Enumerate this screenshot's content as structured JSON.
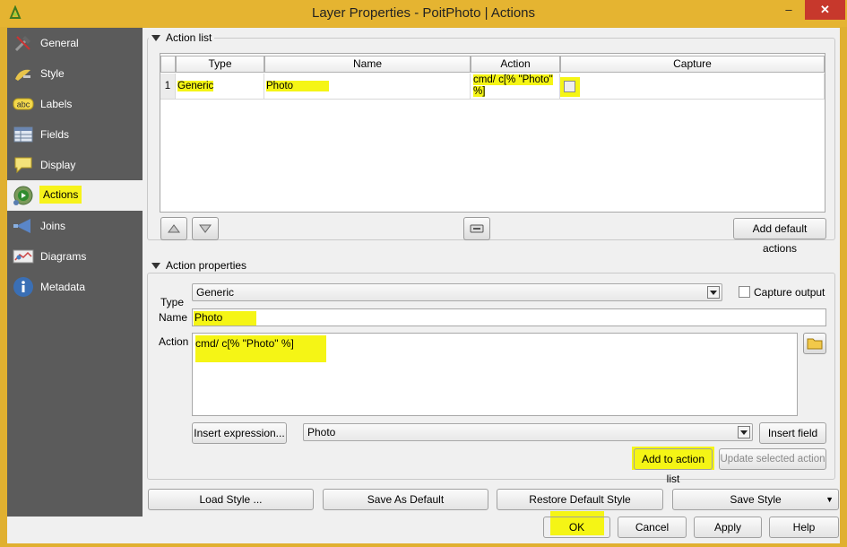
{
  "window": {
    "title": "Layer Properties - PoitPhoto | Actions",
    "minimize_glyph": "–",
    "close_glyph": "✕"
  },
  "sidebar": {
    "items": [
      {
        "label": "General",
        "icon": "general-icon"
      },
      {
        "label": "Style",
        "icon": "style-icon"
      },
      {
        "label": "Labels",
        "icon": "labels-icon"
      },
      {
        "label": "Fields",
        "icon": "fields-icon"
      },
      {
        "label": "Display",
        "icon": "display-icon"
      },
      {
        "label": "Actions",
        "icon": "actions-icon",
        "active": true
      },
      {
        "label": "Joins",
        "icon": "joins-icon"
      },
      {
        "label": "Diagrams",
        "icon": "diagrams-icon"
      },
      {
        "label": "Metadata",
        "icon": "metadata-icon"
      }
    ],
    "labels_icon_text": "abc"
  },
  "action_list": {
    "title": "Action list",
    "columns": [
      "Type",
      "Name",
      "Action",
      "Capture"
    ],
    "rows": [
      {
        "index": "1",
        "type": "Generic",
        "name": "Photo",
        "action": "cmd/ c[% \"Photo\" %]",
        "capture": false
      }
    ],
    "add_default_label": "Add default actions"
  },
  "action_properties": {
    "title": "Action properties",
    "type_label": "Type",
    "type_value": "Generic",
    "capture_output_label": "Capture output",
    "name_label": "Name",
    "name_value": "Photo",
    "action_label": "Action",
    "action_value": "cmd/ c[% \"Photo\" %]",
    "insert_expression_label": "Insert expression...",
    "field_value": "Photo",
    "insert_field_label": "Insert field",
    "add_to_list_label": "Add to action list",
    "update_selected_label": "Update selected action"
  },
  "footer": {
    "load_style": "Load Style ...",
    "save_default": "Save As Default",
    "restore_default": "Restore Default Style",
    "save_style": "Save Style",
    "ok": "OK",
    "cancel": "Cancel",
    "apply": "Apply",
    "help": "Help"
  },
  "colors": {
    "highlight": "#f5f515",
    "titlebar": "#e5b431",
    "sidebar": "#5b5b5b",
    "close_button": "#c7382c"
  }
}
